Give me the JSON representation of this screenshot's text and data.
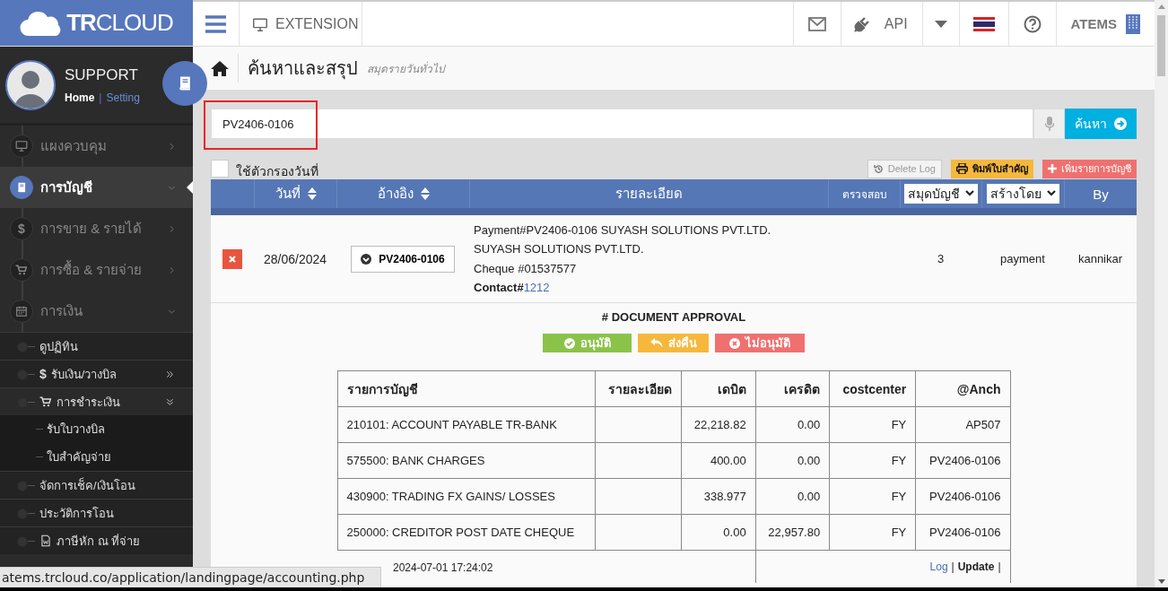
{
  "logo": {
    "text": "**TR**CLOUD"
  },
  "topbar": {
    "extension": "EXTENSION",
    "api": "API",
    "company": "ATEMS"
  },
  "profile": {
    "name": "SUPPORT",
    "home_link": "Home",
    "separator": "|",
    "setting_link": "Setting"
  },
  "sidebar": {
    "items": [
      {
        "label": "แผงควบคุม",
        "kind": "monitor",
        "selected": false,
        "expanded": false
      },
      {
        "label": "การบัญชี",
        "kind": "book",
        "selected": true,
        "expanded": true
      },
      {
        "label": "การขาย & รายได้",
        "glyph": "$",
        "selected": false,
        "expanded": false
      },
      {
        "label": "การซื้อ & รายจ่าย",
        "kind": "cart",
        "selected": false,
        "expanded": false
      },
      {
        "label": "การเงิน",
        "kind": "calendar",
        "selected": false,
        "expanded": true,
        "children": [
          {
            "label": "ดูปฏิทิน"
          },
          {
            "label": "รับเงิน/วางบิล",
            "glyph": "$",
            "expanded": false
          },
          {
            "label": "การชำระเงิน",
            "kind": "cart",
            "expanded": true,
            "children": [
              {
                "label": "รับใบวางบิล"
              },
              {
                "label": "ใบสำคัญจ่าย"
              }
            ]
          },
          {
            "label": "จัดการเช็ค/เงินโอน"
          },
          {
            "label": "ประวัติการโอน"
          },
          {
            "label": "ภาษีหัก ณ ที่จ่าย",
            "kind": "file"
          }
        ]
      }
    ]
  },
  "page": {
    "title": "ค้นหาและสรุป",
    "subtitle": "สมุดรายวันทั่วไป"
  },
  "search": {
    "value": "PV2406-0106",
    "highlighted": true,
    "button": "ค้นหา"
  },
  "date_filter": {
    "label": "ใช้ตัวกรองวันที่",
    "checked": false
  },
  "actions": [
    {
      "kind": "log",
      "label": "Delete Log",
      "disabled": true
    },
    {
      "kind": "print",
      "label": "พิมพ์ใบสำคัญ",
      "disabled": false
    },
    {
      "kind": "add",
      "label": "เพิ่มรายการบัญชี",
      "disabled": false
    }
  ],
  "table": {
    "columns": [
      {
        "label": "วันที่",
        "kind": "sort"
      },
      {
        "label": "อ้างอิง",
        "kind": "sort"
      },
      {
        "label": "รายละเอียด",
        "kind": "text"
      },
      {
        "label": "ตรวจสอบ",
        "kind": "small"
      },
      {
        "label": "สมุดบัญชี",
        "kind": "select"
      },
      {
        "label": "สร้างโดย",
        "kind": "select"
      },
      {
        "label": "By",
        "kind": "text"
      }
    ],
    "rows": [
      {
        "date": "28/06/2024",
        "reference": "PV2406-0106",
        "details": [
          "Payment#PV2406-0106 SUYASH SOLUTIONS PVT.LTD.",
          "SUYASH SOLUTIONS PVT.LTD.",
          "Cheque #01537577"
        ],
        "contact_label": "Contact#",
        "contact_link": "1212",
        "number": "3",
        "book": "payment",
        "by": "kannikar"
      }
    ]
  },
  "approval": {
    "title": "# DOCUMENT APPROVAL",
    "buttons": [
      {
        "kind": "approve",
        "label": "อนุมัติ"
      },
      {
        "kind": "return",
        "label": "ส่งคืน"
      },
      {
        "kind": "reject",
        "label": "ไม่อนุมัติ"
      }
    ]
  },
  "ledger": {
    "columns": [
      "รายการบัญชี",
      "รายละเอียด",
      "เดบิต",
      "เครดิต",
      "costcenter",
      "@Anch"
    ],
    "rows": [
      [
        "210101: ACCOUNT PAYABLE TR-BANK",
        "",
        "22,218.82",
        "0.00",
        "FY",
        "AP507"
      ],
      [
        "575500: BANK CHARGES",
        "",
        "400.00",
        "0.00",
        "FY",
        "PV2406-0106"
      ],
      [
        "430900: TRADING FX GAINS/ LOSSES",
        "",
        "338.977",
        "0.00",
        "FY",
        "PV2406-0106"
      ],
      [
        "250000: CREDITOR POST DATE CHEQUE",
        "",
        "0.00",
        "22,957.80",
        "FY",
        "PV2406-0106"
      ]
    ],
    "created": "2024-07-01 17:24:02",
    "log_link": "Log",
    "separator_1": "|",
    "update_link": "Update",
    "separator_2": "|"
  },
  "status_bar": {
    "url": "atems.trcloud.co/application/landingpage/accounting.php"
  }
}
